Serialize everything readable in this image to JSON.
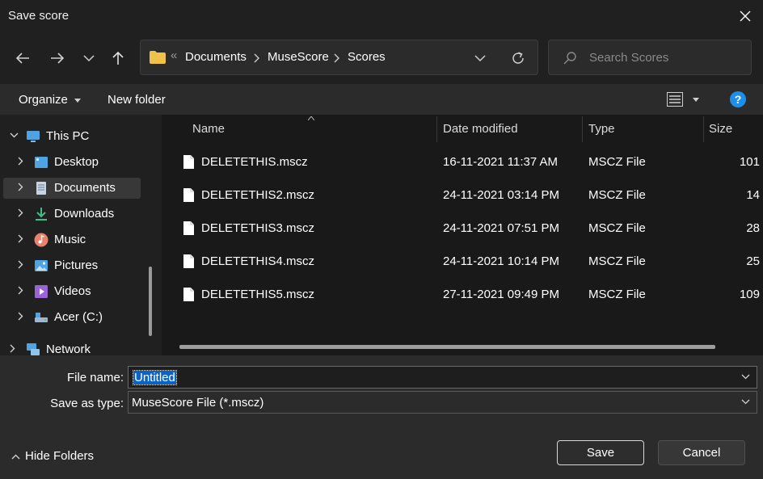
{
  "window": {
    "title": "Save score"
  },
  "address": {
    "segments": [
      "Documents",
      "MuseScore",
      "Scores"
    ],
    "overflow": "«"
  },
  "search": {
    "placeholder": "Search Scores"
  },
  "toolbar": {
    "organize": "Organize",
    "new_folder": "New folder"
  },
  "sidebar": {
    "items": [
      {
        "label": "This PC",
        "icon": "this-pc-icon",
        "color": "#4fa3e0"
      },
      {
        "label": "Desktop",
        "icon": "desktop-icon",
        "color": "#4fa3e0"
      },
      {
        "label": "Documents",
        "icon": "documents-icon",
        "color": "#c8d4e6",
        "selected": true
      },
      {
        "label": "Downloads",
        "icon": "downloads-icon",
        "color": "#3fbf88"
      },
      {
        "label": "Music",
        "icon": "music-icon",
        "color": "#e8826a"
      },
      {
        "label": "Pictures",
        "icon": "pictures-icon",
        "color": "#4fa3e0"
      },
      {
        "label": "Videos",
        "icon": "videos-icon",
        "color": "#9a63d6"
      },
      {
        "label": "Acer (C:)",
        "icon": "drive-icon",
        "color": "#9fb6cc"
      },
      {
        "label": "Network",
        "icon": "network-icon",
        "color": "#4fa3e0"
      }
    ]
  },
  "columns": {
    "name": "Name",
    "date": "Date modified",
    "type": "Type",
    "size": "Size"
  },
  "files": [
    {
      "name": "DELETETHIS.mscz",
      "date": "16-11-2021 11:37 AM",
      "type": "MSCZ File",
      "size": "101"
    },
    {
      "name": "DELETETHIS2.mscz",
      "date": "24-11-2021 03:14 PM",
      "type": "MSCZ File",
      "size": "14"
    },
    {
      "name": "DELETETHIS3.mscz",
      "date": "24-11-2021 07:51 PM",
      "type": "MSCZ File",
      "size": "28"
    },
    {
      "name": "DELETETHIS4.mscz",
      "date": "24-11-2021 10:14 PM",
      "type": "MSCZ File",
      "size": "25"
    },
    {
      "name": "DELETETHIS5.mscz",
      "date": "27-11-2021 09:49 PM",
      "type": "MSCZ File",
      "size": "109"
    }
  ],
  "form": {
    "file_name_label": "File name:",
    "file_name_value": "Untitled",
    "save_type_label": "Save as type:",
    "save_type_value": "MuseScore File (*.mscz)"
  },
  "buttons": {
    "save": "Save",
    "cancel": "Cancel",
    "hide_folders": "Hide Folders"
  },
  "colors": {
    "accent": "#0a64c8",
    "help": "#1e8ee8",
    "folder": "#f0c24a"
  }
}
